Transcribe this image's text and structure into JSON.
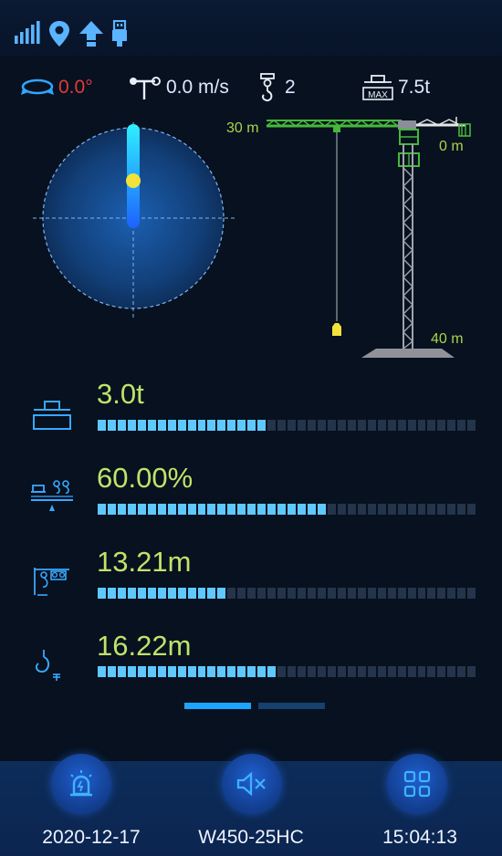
{
  "status_bar": {
    "icons": [
      "signal-icon",
      "location-icon",
      "upload-icon",
      "usb-icon"
    ]
  },
  "info_row": {
    "slew_angle": "0.0°",
    "wind_speed": "0.0 m/s",
    "hook_falls": "2",
    "max_load": "7.5t",
    "max_badge": "MAX"
  },
  "crane": {
    "jib_length": "30 m",
    "trolley_zero": "0 m",
    "tower_height": "40 m"
  },
  "metrics": [
    {
      "icon": "load-weight-icon",
      "value": "3.0t",
      "fill": 0.44
    },
    {
      "icon": "moment-ratio-icon",
      "value": "60.00%",
      "fill": 0.6
    },
    {
      "icon": "trolley-radius-icon",
      "value": "13.21m",
      "fill": 0.33
    },
    {
      "icon": "hook-height-icon",
      "value": "16.22m",
      "fill": 0.47
    }
  ],
  "pager": {
    "pages": 2,
    "active": 0
  },
  "bottom_bar": {
    "date": "2020-12-17",
    "model": "W450-25HC",
    "time": "15:04:13",
    "icons": [
      "alarm-icon",
      "mute-icon",
      "menu-grid-icon"
    ]
  },
  "colors": {
    "accent": "#1ca5ff",
    "value_green": "#bfe36a",
    "alarm_red": "#e23a3a",
    "crane_green": "#46b83a",
    "hook_yellow": "#f2e23a"
  }
}
